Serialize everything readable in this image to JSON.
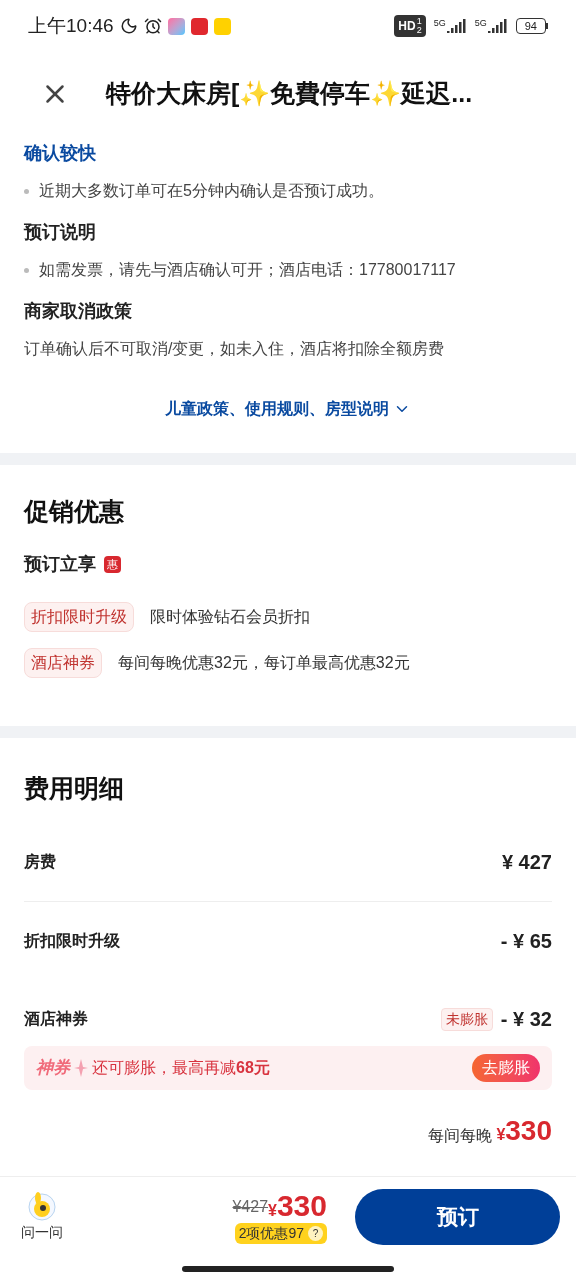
{
  "status_bar": {
    "time": "上午10:46",
    "hd": {
      "label": "HD",
      "sub": [
        "1",
        "2"
      ]
    },
    "networks": [
      "5G",
      "5G"
    ],
    "battery": "94"
  },
  "header": {
    "title": "特价大床房[✨免費停车✨延迟..."
  },
  "notices": [
    {
      "kind": "accent",
      "title": "确认较快",
      "lines": [
        "近期大多数订单可在5分钟内确认是否预订成功。"
      ]
    },
    {
      "kind": "bullet",
      "title": "预订说明",
      "lines": [
        "如需发票，请先与酒店确认可开；酒店电话：17780017117"
      ]
    },
    {
      "kind": "plain",
      "title": "商家取消政策",
      "lines": [
        "订单确认后不可取消/变更，如未入住，酒店将扣除全额房费"
      ]
    }
  ],
  "more_link": "儿童政策、使用规则、房型说明",
  "promo": {
    "title": "促销优惠",
    "subtitle": "预订立享",
    "badge": "惠",
    "items": [
      {
        "tag": "折扣限时升级",
        "text": "限时体验钻石会员折扣"
      },
      {
        "tag": "酒店神券",
        "text": "每间每晚优惠32元，每订单最高优惠32元"
      }
    ]
  },
  "fees": {
    "title": "费用明细",
    "rows": [
      {
        "label": "房费",
        "amount": "¥ 427",
        "divider": true
      },
      {
        "label": "折扣限时升级",
        "amount": "- ¥ 65",
        "divider": false
      },
      {
        "label": "酒店神券",
        "tag": "未膨胀",
        "amount": "- ¥ 32",
        "divider": false
      }
    ],
    "banner": {
      "brand": "神券",
      "text": "还可膨胀，最高再减**68元**",
      "button": "去膨胀"
    },
    "per_night": {
      "label": "每间每晚",
      "currency": "¥",
      "amount": "330"
    }
  },
  "bottom_bar": {
    "ask": "问一问",
    "original_price": "¥427",
    "currency": "¥",
    "price": "330",
    "discount": "2项优惠97",
    "help": "?",
    "book": "预订"
  }
}
